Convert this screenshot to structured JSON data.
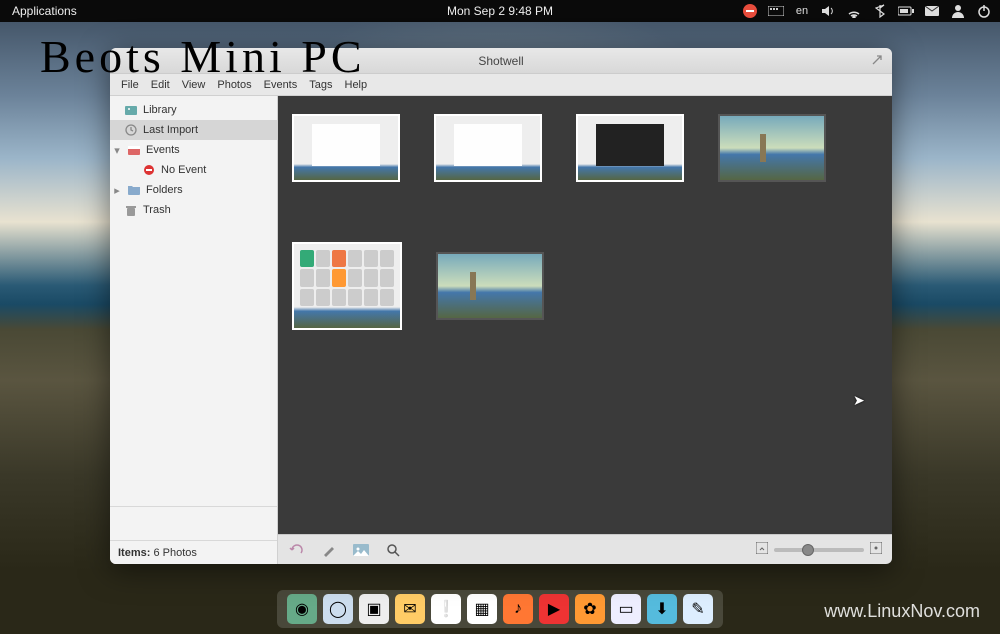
{
  "topbar": {
    "applications": "Applications",
    "clock": "Mon Sep 2  9:48 PM",
    "language": "en"
  },
  "overlay": "Beots Mini PC",
  "watermark": "www.LinuxNov.com",
  "window": {
    "title": "Shotwell",
    "menu": [
      "File",
      "Edit",
      "View",
      "Photos",
      "Events",
      "Tags",
      "Help"
    ],
    "sidebar": {
      "items": [
        {
          "label": "Library",
          "icon": "library"
        },
        {
          "label": "Last Import",
          "icon": "clock",
          "selected": true
        },
        {
          "label": "Events",
          "icon": "events",
          "expandable": true,
          "expanded": true
        },
        {
          "label": "No Event",
          "icon": "no-event",
          "child": true
        },
        {
          "label": "Folders",
          "icon": "folder",
          "expandable": true,
          "expanded": false
        },
        {
          "label": "Trash",
          "icon": "trash"
        }
      ]
    },
    "status": {
      "prefix": "Items:",
      "value": "6 Photos"
    },
    "thumbnails": [
      {
        "kind": "app-window"
      },
      {
        "kind": "app-window"
      },
      {
        "kind": "dark-window"
      },
      {
        "kind": "landscape"
      },
      {
        "kind": "app-grid",
        "big": true
      },
      {
        "kind": "landscape"
      }
    ]
  },
  "dock": {
    "items": [
      {
        "name": "web-browser",
        "color": "#6a8",
        "glyph": "◉"
      },
      {
        "name": "chromium",
        "color": "#cde",
        "glyph": "◯"
      },
      {
        "name": "files",
        "color": "#eee",
        "glyph": "▣"
      },
      {
        "name": "mail",
        "color": "#fc6",
        "glyph": "✉"
      },
      {
        "name": "notes",
        "color": "#fff",
        "glyph": "❕"
      },
      {
        "name": "calendar",
        "color": "#fff",
        "glyph": "▦"
      },
      {
        "name": "music",
        "color": "#f73",
        "glyph": "♪"
      },
      {
        "name": "video",
        "color": "#e33",
        "glyph": "▶"
      },
      {
        "name": "photos",
        "color": "#f93",
        "glyph": "✿"
      },
      {
        "name": "terminal",
        "color": "#eef",
        "glyph": "▭"
      },
      {
        "name": "downloads",
        "color": "#5bd",
        "glyph": "⬇"
      },
      {
        "name": "text-editor",
        "color": "#def",
        "glyph": "✎"
      }
    ]
  }
}
